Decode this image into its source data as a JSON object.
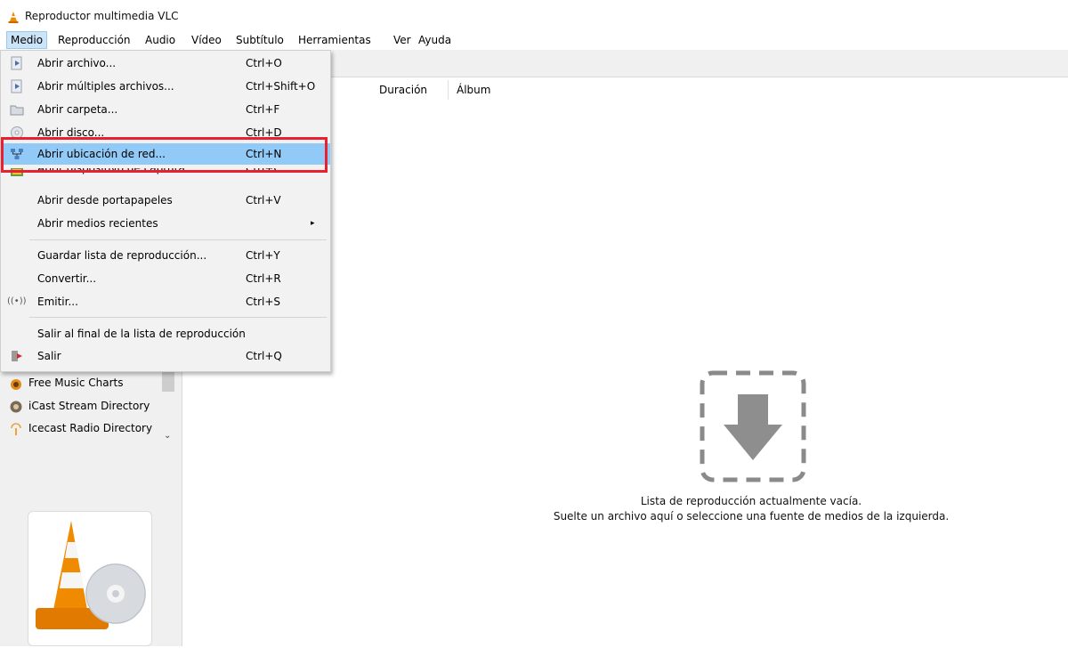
{
  "window": {
    "title": "Reproductor multimedia VLC"
  },
  "menubar": {
    "items": [
      "Medio",
      "Reproducción",
      "Audio",
      "Vídeo",
      "Subtítulo",
      "Herramientas",
      "Ver",
      "Ayuda"
    ]
  },
  "medio_menu": {
    "items": [
      {
        "label": "Abrir archivo...",
        "shortcut": "Ctrl+O",
        "icon": "play-file-icon"
      },
      {
        "label": "Abrir múltiples archivos...",
        "shortcut": "Ctrl+Shift+O",
        "icon": "play-file-icon"
      },
      {
        "label": "Abrir carpeta...",
        "shortcut": "Ctrl+F",
        "icon": "folder-icon"
      },
      {
        "label": "Abrir disco...",
        "shortcut": "Ctrl+D",
        "icon": "disc-icon"
      },
      {
        "label": "Abrir ubicación de red...",
        "shortcut": "Ctrl+N",
        "icon": "network-icon"
      },
      {
        "label": "Abrir dispositivo de captura...",
        "shortcut": "Ctrl+C",
        "icon": "capture-device-icon"
      },
      {
        "label": "Abrir desde portapapeles",
        "shortcut": "Ctrl+V",
        "icon": ""
      },
      {
        "label": "Abrir medios recientes",
        "shortcut": "",
        "icon": ""
      },
      {
        "label": "Guardar lista de reproducción...",
        "shortcut": "Ctrl+Y",
        "icon": ""
      },
      {
        "label": "Convertir...",
        "shortcut": "Ctrl+R",
        "icon": ""
      },
      {
        "label": "Emitir...",
        "shortcut": "Ctrl+S",
        "icon": "stream-icon"
      },
      {
        "label": "Salir al final de la lista de reproducción",
        "shortcut": "",
        "icon": ""
      },
      {
        "label": "Salir",
        "shortcut": "Ctrl+Q",
        "icon": "exit-icon"
      }
    ],
    "highlighted_index": 4,
    "submenu_arrow": "▸"
  },
  "playlist": {
    "columns": [
      "Duración",
      "Álbum"
    ],
    "empty_line_1": "Lista de reproducción actualmente vacía.",
    "empty_line_2": "Suelte un archivo aquí o seleccione una fuente de medios de la izquierda."
  },
  "sidebar": {
    "items": [
      "Free Music Charts",
      "iCast Stream Directory",
      "Icecast Radio Directory"
    ]
  },
  "colors": {
    "highlight": "#91c9f7",
    "red_outline": "#e8202f",
    "vlc_orange": "#f08a00"
  }
}
